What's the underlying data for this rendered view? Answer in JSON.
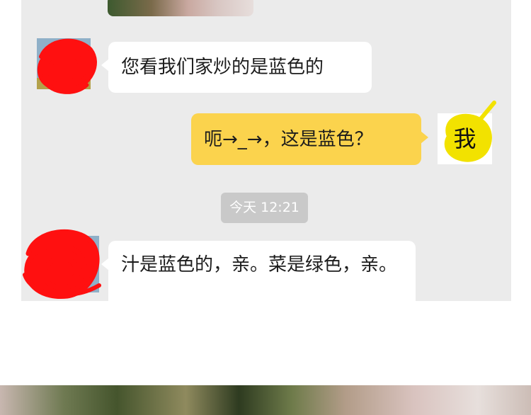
{
  "messages": [
    {
      "side": "left",
      "text": "您看我们家炒的是蓝色的"
    },
    {
      "side": "right",
      "text": "呃→_→，这是蓝色？"
    },
    {
      "side": "left",
      "text": "汁是蓝色的，亲。菜是绿色，亲。"
    }
  ],
  "timestamp": "今天 12:21",
  "me_avatar_label": "我",
  "colors": {
    "chat_background": "#ebebeb",
    "incoming_bubble": "#ffffff",
    "outgoing_bubble": "#fbd34d",
    "timestamp_pill": "#c9c9c9",
    "scribble_red": "#ff1010",
    "scribble_yellow": "#f2e200"
  }
}
